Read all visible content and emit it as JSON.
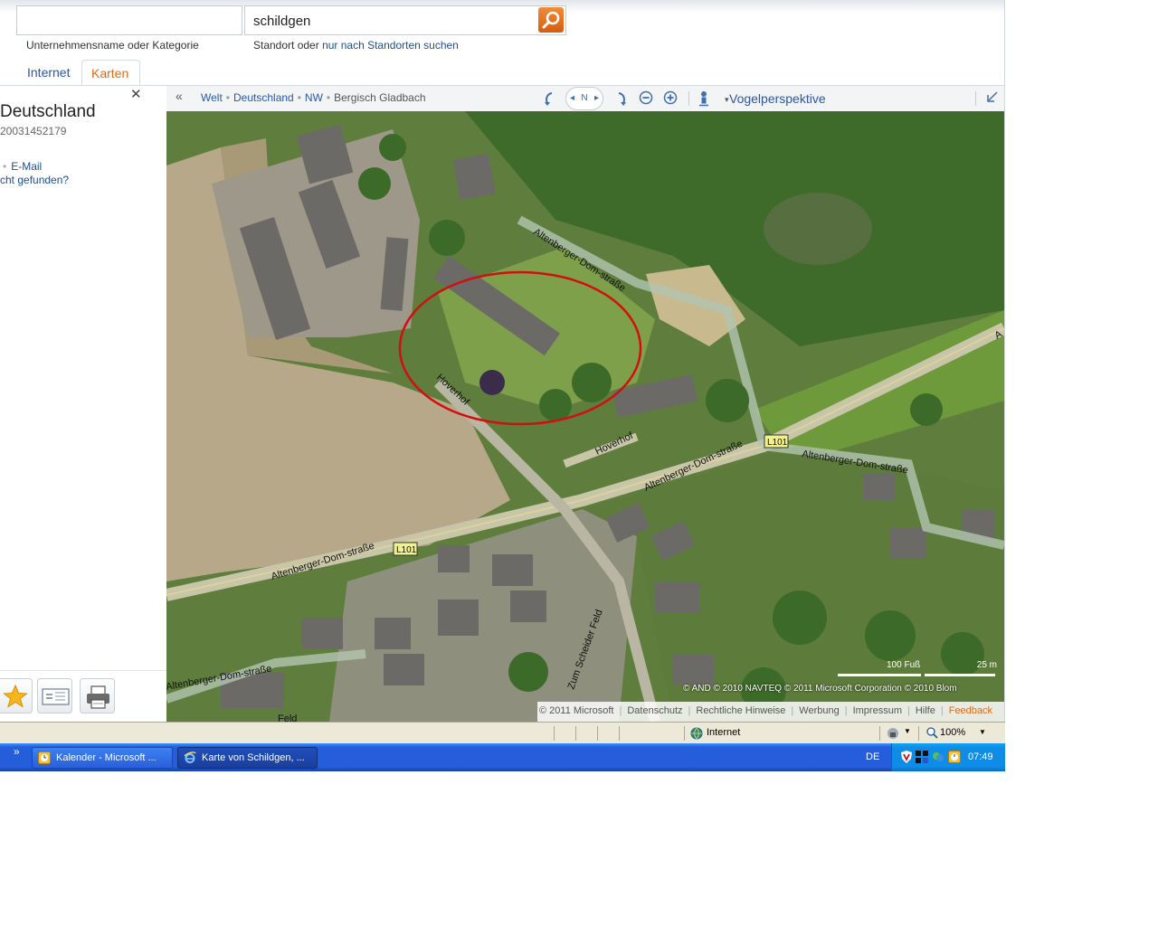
{
  "search": {
    "what_value": "",
    "where_value": "schildgen",
    "what_hint": "Unternehmensname oder Kategorie",
    "where_hint_prefix": "Standort oder",
    "where_hint_link": "nur nach Standorten suchen"
  },
  "tabs": [
    {
      "label": "Internet",
      "active": false
    },
    {
      "label": "Karten",
      "active": true
    }
  ],
  "panel": {
    "title": "Deutschland",
    "phone": "20031452179",
    "email": "E-Mail",
    "not_found": "cht gefunden?"
  },
  "breadcrumb": [
    "Welt",
    "Deutschland",
    "NW",
    "Bergisch Gladbach"
  ],
  "map_toolbar": {
    "compass": "N",
    "view_mode": "Vogelperspektive"
  },
  "map": {
    "labels": {
      "road1": "Altenberger-Dom-straße",
      "road2": "Altenberger-Dom-straße",
      "road3": "Altenberger-Dom-straße",
      "road4": "Altenberger-Dom-straße",
      "road5": "Altenberger-Dom-straße",
      "hoverhof1": "Hoverhof",
      "hoverhof2": "Hoverhof",
      "zum_scheider_feld": "Zum Scheider Feld",
      "feld": "Feld",
      "shield1": "L101",
      "shield2": "L101",
      "edge_a": "A"
    },
    "scale_left": "100 Fuß",
    "scale_right": "25 m",
    "copyright": "© AND   © 2010 NAVTEQ   © 2011 Microsoft Corporation   © 2010 Blom",
    "footer": {
      "copyright": "© 2011 Microsoft",
      "links": [
        "Datenschutz",
        "Rechtliche Hinweise",
        "Werbung",
        "Impressum",
        "Hilfe"
      ],
      "feedback": "Feedback"
    }
  },
  "statusbar": {
    "zone": "Internet",
    "zoom": "100%"
  },
  "taskbar": {
    "tasks": [
      {
        "label": "Kalender - Microsoft ...",
        "active": false
      },
      {
        "label": "Karte von Schildgen, ...",
        "active": true
      }
    ],
    "more": "»",
    "language": "DE",
    "clock": "07:49"
  },
  "colors": {
    "accent_orange": "#e06a14",
    "link_blue": "#2b57a8",
    "highlight_ellipse": "#d01010",
    "taskbar_blue": "#245edb"
  }
}
